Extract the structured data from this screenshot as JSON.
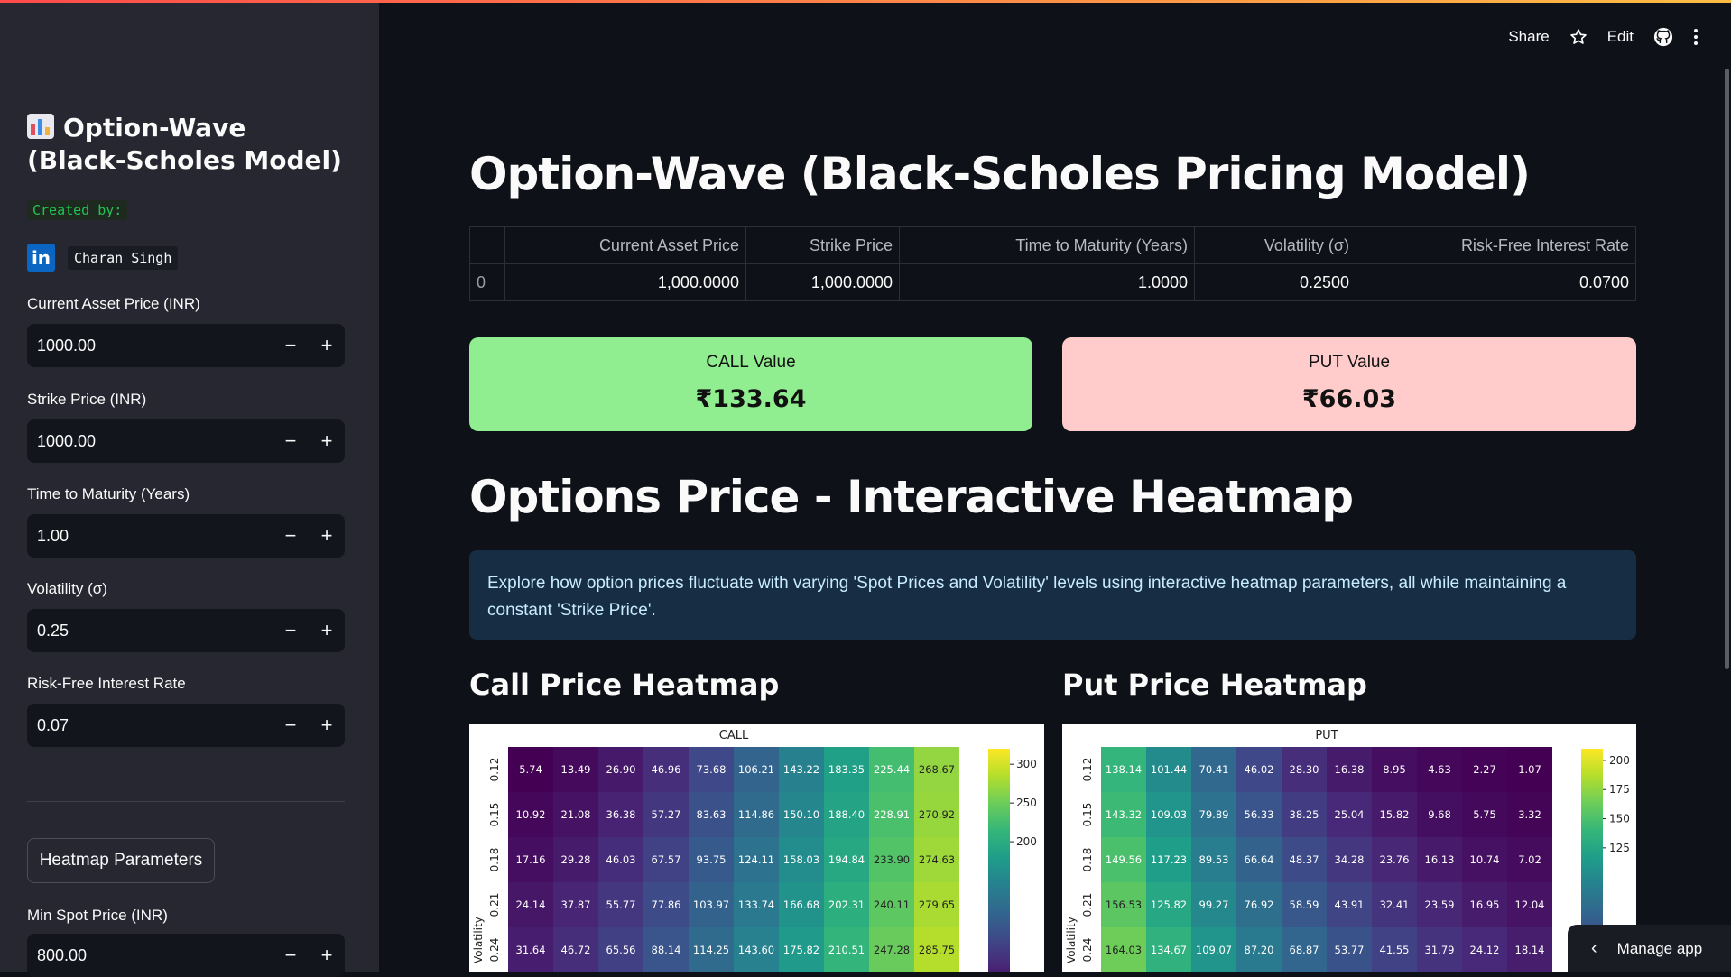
{
  "sidebar": {
    "title": "Option-Wave (Black-Scholes Model)",
    "created_by": "Created by:",
    "author": "Charan Singh",
    "linkedin_icon_text": "in",
    "inputs": [
      {
        "label": "Current Asset Price (INR)",
        "value": "1000.00"
      },
      {
        "label": "Strike Price (INR)",
        "value": "1000.00"
      },
      {
        "label": "Time to Maturity (Years)",
        "value": "1.00"
      },
      {
        "label": "Volatility (σ)",
        "value": "0.25"
      },
      {
        "label": "Risk-Free Interest Rate",
        "value": "0.07"
      }
    ],
    "minus": "−",
    "plus": "+",
    "heatmap_button": "Heatmap Parameters",
    "min_spot": {
      "label": "Min Spot Price (INR)",
      "value": "800.00"
    }
  },
  "header": {
    "share": "Share",
    "edit": "Edit"
  },
  "main": {
    "title": "Option-Wave (Black-Scholes Pricing Model)",
    "table": {
      "headers": [
        "",
        "Current Asset Price",
        "Strike Price",
        "Time to Maturity (Years)",
        "Volatility (σ)",
        "Risk-Free Interest Rate"
      ],
      "row": [
        "0",
        "1,000.0000",
        "1,000.0000",
        "1.0000",
        "0.2500",
        "0.0700"
      ]
    },
    "call_card": {
      "label": "CALL Value",
      "value": "₹133.64",
      "color": "#90ee90"
    },
    "put_card": {
      "label": "PUT Value",
      "value": "₹66.03",
      "color": "#ffcccb"
    },
    "heatmap_heading": "Options Price - Interactive Heatmap",
    "info": "Explore how option prices fluctuate with varying 'Spot Prices and Volatility' levels using interactive heatmap parameters, all while maintaining a constant 'Strike Price'.",
    "call_heatmap_title": "Call Price Heatmap",
    "put_heatmap_title": "Put Price Heatmap"
  },
  "manage_app": "Manage app",
  "chart_data": [
    {
      "type": "heatmap",
      "title": "CALL",
      "ylabel": "Volatility",
      "y_ticks": [
        "0.12",
        "0.15",
        "0.18",
        "0.21",
        "0.24"
      ],
      "colorbar_ticks": [
        300,
        250,
        200
      ],
      "colorscale": "viridis",
      "vmin": 5.74,
      "vmax": 320,
      "values": [
        [
          5.74,
          13.49,
          26.9,
          46.96,
          73.68,
          106.21,
          143.22,
          183.35,
          225.44,
          268.67
        ],
        [
          10.92,
          21.08,
          36.38,
          57.27,
          83.63,
          114.86,
          150.1,
          188.4,
          228.91,
          270.92
        ],
        [
          17.16,
          29.28,
          46.03,
          67.57,
          93.75,
          124.11,
          158.03,
          194.84,
          233.9,
          274.63
        ],
        [
          24.14,
          37.87,
          55.77,
          77.86,
          103.97,
          133.74,
          166.68,
          202.31,
          240.11,
          279.65
        ],
        [
          31.64,
          46.72,
          65.56,
          88.14,
          114.25,
          143.6,
          175.82,
          210.51,
          247.28,
          285.75
        ]
      ]
    },
    {
      "type": "heatmap",
      "title": "PUT",
      "ylabel": "Volatility",
      "y_ticks": [
        "0.12",
        "0.15",
        "0.18",
        "0.21",
        "0.24"
      ],
      "colorbar_ticks": [
        200,
        175,
        150,
        125
      ],
      "colorscale": "viridis",
      "vmin": 1.07,
      "vmax": 210,
      "values": [
        [
          138.14,
          101.44,
          70.41,
          46.02,
          28.3,
          16.38,
          8.95,
          4.63,
          2.27,
          1.07
        ],
        [
          143.32,
          109.03,
          79.89,
          56.33,
          38.25,
          25.04,
          15.82,
          9.68,
          5.75,
          3.32
        ],
        [
          149.56,
          117.23,
          89.53,
          66.64,
          48.37,
          34.28,
          23.76,
          16.13,
          10.74,
          7.02
        ],
        [
          156.53,
          125.82,
          99.27,
          76.92,
          58.59,
          43.91,
          32.41,
          23.59,
          16.95,
          12.04
        ],
        [
          164.03,
          134.67,
          109.07,
          87.2,
          68.87,
          53.77,
          41.55,
          31.79,
          24.12,
          18.14
        ]
      ]
    }
  ]
}
